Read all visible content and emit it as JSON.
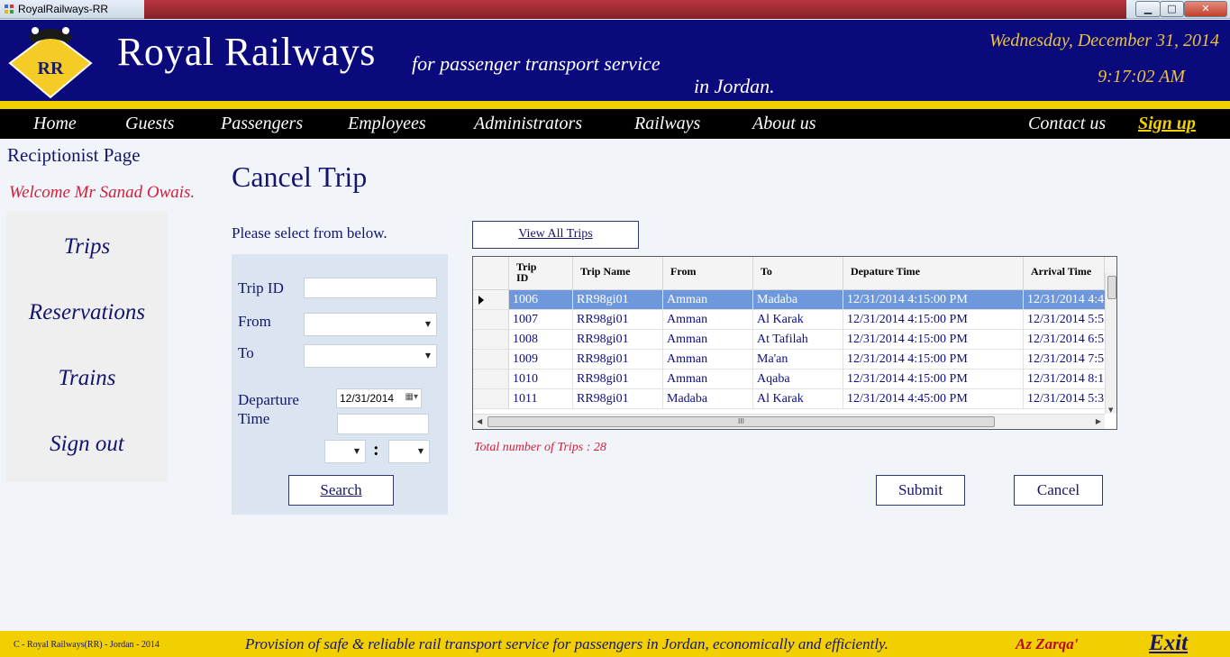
{
  "window": {
    "title": "RoyalRailways-RR",
    "min": "▁",
    "max": "□",
    "close": "✕"
  },
  "header": {
    "brand": "Royal Railways",
    "logo_text": "RR",
    "tagline_line1": "for passenger transport service",
    "tagline_line2": "in Jordan.",
    "date": "Wednesday, December 31, 2014",
    "time": "9:17:02 AM"
  },
  "nav": {
    "home": "Home",
    "guests": "Guests",
    "passengers": "Passengers",
    "employees": "Employees",
    "administrators": "Administrators",
    "railways": "Railways",
    "about": "About us",
    "contact": "Contact us",
    "signup": "Sign up"
  },
  "left": {
    "page_name": "Reciptionist Page",
    "welcome": "Welcome Mr Sanad Owais.",
    "menu": {
      "trips": "Trips",
      "reservations": "Reservations",
      "trains": "Trains",
      "signout": "Sign out"
    }
  },
  "main": {
    "title": "Cancel Trip",
    "select_text": "Please select from below.",
    "filters": {
      "trip_id_label": "Trip ID",
      "trip_id_value": "",
      "from_label": "From",
      "from_value": "",
      "to_label": "To",
      "to_value": "",
      "departure_label_1": "Departure",
      "departure_label_2": "Time",
      "date_value": "12/31/2014",
      "time_value": "",
      "hour_value": "",
      "minute_value": "",
      "colon": ":"
    },
    "search_label": "Search",
    "view_all_label": "View All Trips",
    "submit_label": "Submit",
    "cancel_label": "Cancel",
    "total_text": "Total number of Trips : 28"
  },
  "grid": {
    "columns": {
      "trip_id_1": "Trip",
      "trip_id_2": "ID",
      "trip_name": "Trip Name",
      "from": "From",
      "to": "To",
      "departure": "Depature Time",
      "arrival": "Arrival Time"
    },
    "rows": [
      {
        "id": "1006",
        "name": "RR98gi01",
        "from": "Amman",
        "to": "Madaba",
        "dep": "12/31/2014 4:15:00 PM",
        "arr": "12/31/2014 4:4"
      },
      {
        "id": "1007",
        "name": "RR98gi01",
        "from": "Amman",
        "to": "Al Karak",
        "dep": "12/31/2014 4:15:00 PM",
        "arr": "12/31/2014 5:5"
      },
      {
        "id": "1008",
        "name": "RR98gi01",
        "from": "Amman",
        "to": "At Tafilah",
        "dep": "12/31/2014 4:15:00 PM",
        "arr": "12/31/2014 6:5"
      },
      {
        "id": "1009",
        "name": "RR98gi01",
        "from": "Amman",
        "to": "Ma'an",
        "dep": "12/31/2014 4:15:00 PM",
        "arr": "12/31/2014 7:5"
      },
      {
        "id": "1010",
        "name": "RR98gi01",
        "from": "Amman",
        "to": "Aqaba",
        "dep": "12/31/2014 4:15:00 PM",
        "arr": "12/31/2014 8:1"
      },
      {
        "id": "1011",
        "name": "RR98gi01",
        "from": "Madaba",
        "to": "Al Karak",
        "dep": "12/31/2014 4:45:00 PM",
        "arr": "12/31/2014 5:3"
      }
    ],
    "scroll_grip": "III"
  },
  "footer": {
    "copyright": "C - Royal Railways(RR) - Jordan - 2014",
    "mission": "Provision of safe & reliable rail transport service for passengers in Jordan, economically and efficiently.",
    "location": "Az Zarqa'",
    "exit": "Exit"
  },
  "colors": {
    "navy": "#0b0a7c",
    "gold": "#f2cf00",
    "crimson": "#d3203a",
    "selected_row": "#6f97db"
  },
  "icons": [
    "app-icon",
    "logo-icon",
    "dropdown-arrow-icon",
    "calendar-icon",
    "row-selector-icon",
    "scroll-arrow-icon"
  ]
}
